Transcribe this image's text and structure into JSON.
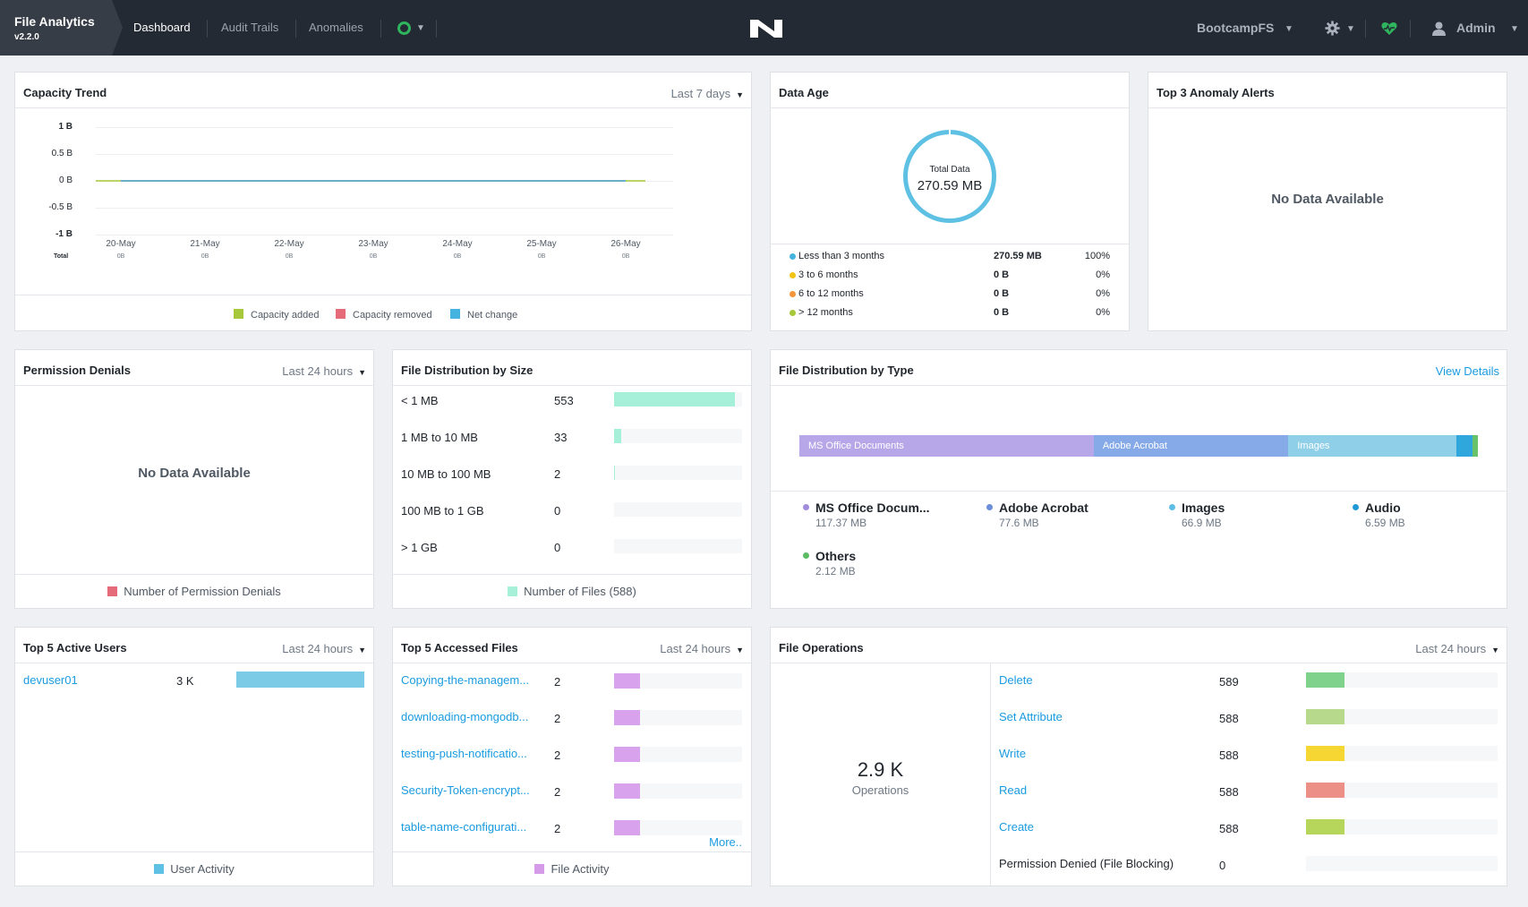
{
  "app": {
    "title": "File Analytics",
    "version": "v2.2.0"
  },
  "nav": {
    "dashboard": "Dashboard",
    "audit": "Audit Trails",
    "anomalies": "Anomalies"
  },
  "header": {
    "fs": "BootcampFS",
    "user": "Admin"
  },
  "capacity": {
    "title": "Capacity Trend",
    "range": "Last 7 days",
    "total_label": "Total",
    "legend": {
      "added": "Capacity added",
      "removed": "Capacity removed",
      "net": "Net change"
    },
    "chart_data": {
      "type": "line",
      "x": [
        "20-May",
        "21-May",
        "22-May",
        "23-May",
        "24-May",
        "25-May",
        "26-May"
      ],
      "totals": [
        "0B",
        "0B",
        "0B",
        "0B",
        "0B",
        "0B",
        "0B"
      ],
      "y_ticks": [
        "1 B",
        "0.5 B",
        "0 B",
        "-0.5 B",
        "-1 B"
      ],
      "ylim": [
        -1,
        1
      ],
      "series": [
        {
          "name": "Capacity added",
          "values": [
            0,
            0,
            0,
            0,
            0,
            0,
            0
          ],
          "color": "#a6c83a"
        },
        {
          "name": "Capacity removed",
          "values": [
            0,
            0,
            0,
            0,
            0,
            0,
            0
          ],
          "color": "#e56a7a"
        },
        {
          "name": "Net change",
          "values": [
            0,
            0,
            0,
            0,
            0,
            0,
            0
          ],
          "color": "#45b3e0"
        }
      ]
    }
  },
  "data_age": {
    "title": "Data Age",
    "total_label": "Total Data",
    "total_value": "270.59 MB",
    "rows": [
      {
        "label": "Less than 3 months",
        "size": "270.59 MB",
        "pct": "100%",
        "color": "#45b3e0"
      },
      {
        "label": "3 to 6 months",
        "size": "0 B",
        "pct": "0%",
        "color": "#f3c315"
      },
      {
        "label": "6 to 12 months",
        "size": "0 B",
        "pct": "0%",
        "color": "#f39539"
      },
      {
        "label": "> 12 months",
        "size": "0 B",
        "pct": "0%",
        "color": "#a6c83a"
      }
    ]
  },
  "anomaly": {
    "title": "Top 3 Anomaly Alerts",
    "empty": "No Data Available"
  },
  "permission": {
    "title": "Permission Denials",
    "range": "Last 24 hours",
    "empty": "No Data Available",
    "legend": "Number of Permission Denials"
  },
  "size_dist": {
    "title": "File Distribution by Size",
    "legend": "Number of Files (588)",
    "max": 553,
    "rows": [
      {
        "label": "< 1 MB",
        "value": 553
      },
      {
        "label": "1 MB to 10 MB",
        "value": 33
      },
      {
        "label": "10 MB to 100 MB",
        "value": 2
      },
      {
        "label": "100 MB to 1 GB",
        "value": 0
      },
      {
        "label": "> 1 GB",
        "value": 0
      }
    ]
  },
  "type_dist": {
    "title": "File Distribution by Type",
    "link": "View Details",
    "bar": [
      {
        "label": "MS Office Documents",
        "share": 0.4338,
        "color": "#b8a7e8"
      },
      {
        "label": "Adobe Acrobat",
        "share": 0.287,
        "color": "#86a9e8"
      },
      {
        "label": "Images",
        "share": 0.2473,
        "color": "#8fcfe8"
      },
      {
        "label": "",
        "share": 0.0244,
        "color": "#2fa6dc"
      },
      {
        "label": "",
        "share": 0.0075,
        "color": "#67c26a"
      }
    ],
    "items": [
      {
        "name": "MS Office Docum...",
        "size": "117.37 MB",
        "color": "#a08cdb"
      },
      {
        "name": "Adobe Acrobat",
        "size": "77.6 MB",
        "color": "#6a8ed9"
      },
      {
        "name": "Images",
        "size": "66.9 MB",
        "color": "#5ebde6"
      },
      {
        "name": "Audio",
        "size": "6.59 MB",
        "color": "#1f9ad6"
      },
      {
        "name": "Others",
        "size": "2.12 MB",
        "color": "#5dbb63"
      }
    ]
  },
  "active_users": {
    "title": "Top 5 Active Users",
    "range": "Last 24 hours",
    "legend": "User Activity",
    "rows": [
      {
        "user": "devuser01",
        "value": "3 K",
        "fraction": 1
      }
    ]
  },
  "accessed": {
    "title": "Top 5 Accessed Files",
    "range": "Last 24 hours",
    "legend": "File Activity",
    "more": "More..",
    "rows": [
      {
        "file": "Copying-the-managem...",
        "value": "2",
        "fraction": 0.2
      },
      {
        "file": "downloading-mongodb...",
        "value": "2",
        "fraction": 0.2
      },
      {
        "file": "testing-push-notificatio...",
        "value": "2",
        "fraction": 0.2
      },
      {
        "file": "Security-Token-encrypt...",
        "value": "2",
        "fraction": 0.2
      },
      {
        "file": "table-name-configurati...",
        "value": "2",
        "fraction": 0.2
      }
    ]
  },
  "operations": {
    "title": "File Operations",
    "range": "Last 24 hours",
    "total": "2.9 K",
    "total_label": "Operations",
    "rows": [
      {
        "label": "Delete",
        "value": "589",
        "fraction": 0.2,
        "color": "#7fd28b"
      },
      {
        "label": "Set Attribute",
        "value": "588",
        "fraction": 0.2,
        "color": "#b7d98c"
      },
      {
        "label": "Write",
        "value": "588",
        "fraction": 0.2,
        "color": "#f5d633"
      },
      {
        "label": "Read",
        "value": "588",
        "fraction": 0.2,
        "color": "#ec8f87"
      },
      {
        "label": "Create",
        "value": "588",
        "fraction": 0.2,
        "color": "#b5d65a"
      },
      {
        "label": "Permission Denied (File Blocking)",
        "value": "0",
        "fraction": 0,
        "color": "#cccccc"
      }
    ]
  }
}
